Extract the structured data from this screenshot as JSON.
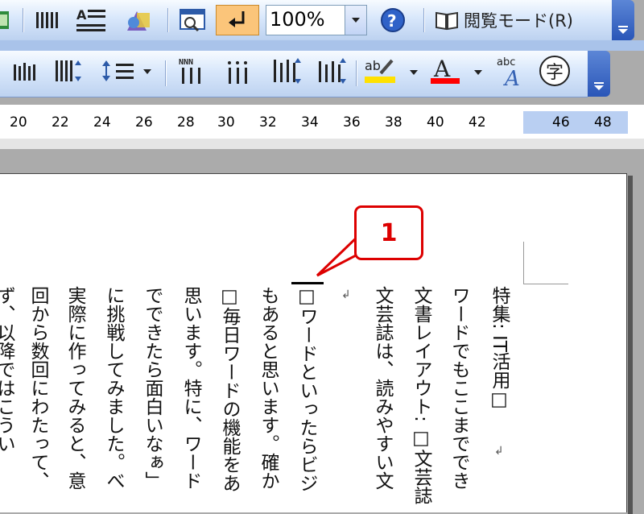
{
  "toolbar1": {
    "zoom_value": "100%",
    "reading_mode_label": "閲覧モード(R)"
  },
  "ruler": {
    "numbers": [
      "20",
      "22",
      "24",
      "26",
      "28",
      "30",
      "32",
      "34",
      "36",
      "38",
      "40",
      "42",
      "46",
      "48"
    ]
  },
  "document": {
    "columns": [
      "特集: IT活用□",
      "ワードでもここまででき",
      "文書レイアウト: □文芸誌",
      "文芸誌は、読みやすい文",
      "□ワードといったらビジ",
      "もあると思います。確か",
      "□毎日ワードの機能をあ",
      "思います。特に、ワード",
      "でできたら面白いなぁ」",
      "に挑戦してみました。べ",
      "実際に作ってみると、意",
      "回から数回にわたって、",
      "ず、以降ではこうい"
    ]
  },
  "callout": {
    "label": "1"
  },
  "colors": {
    "callout_red": "#dd0000",
    "toolbar_blue": "#d8e7fb"
  }
}
